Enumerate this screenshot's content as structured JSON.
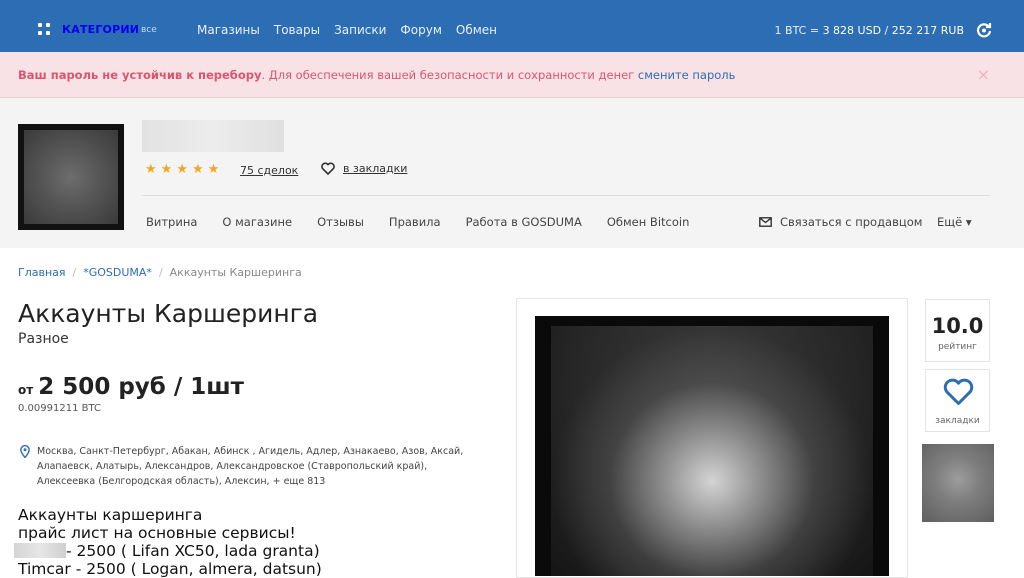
{
  "topbar": {
    "categories_label": "КАТЕГОРИИ",
    "categories_all": "все",
    "nav": [
      "Магазины",
      "Товары",
      "Записки",
      "Форум",
      "Обмен"
    ],
    "rate_prefix": "1 BTC = ",
    "rate_usd": "3 828 USD",
    "rate_sep": " / ",
    "rate_rub": "252 217 RUB"
  },
  "alert": {
    "bold": "Ваш пароль не устойчив к перебору",
    "text": ". Для обеспечения вашей безопасности и сохранности денег ",
    "link": "смените пароль",
    "close": "×"
  },
  "shop": {
    "rating_stars": 5,
    "deals": "75 сделок",
    "bookmark": "в закладки",
    "nav": [
      "Витрина",
      "О магазине",
      "Отзывы",
      "Правила",
      "Работа в GOSDUMA",
      "Обмен Bitcoin"
    ],
    "contact": "Связаться с продавцом",
    "more": "Ещё ▾"
  },
  "breadcrumb": {
    "home": "Главная",
    "sep": "/",
    "shop": "*GOSDUMA*",
    "current": "Аккаунты Каршеринга"
  },
  "product": {
    "title": "Аккаунты Каршеринга",
    "category": "Разное",
    "price_from": "от",
    "price": "2 500 руб / 1шт",
    "price_btc": "0.00991211 BTC",
    "cities": "Москва, Санкт-Петербург, Абакан, Абинск , Агидель, Адлер, Азнакаево, Азов, Аксай, Алапаевск, Алатырь, Александров, Александровское (Ставропольский край), Алексеевка (Белгородская область), Алексин, + еще 813",
    "desc_line1": "Аккаунты каршеринга",
    "desc_line2": "прайс лист на основные сервисы!",
    "desc_line3": "- 2500 ( Lifan XC50, lada granta)",
    "desc_line4": "Timcar - 2500 ( Logan, almera, datsun)"
  },
  "rail": {
    "rating": "10.0",
    "rating_label": "рейтинг",
    "fav_label": "закладки"
  },
  "colors": {
    "topbar": "#2c6db3",
    "alert_bg": "#f9e2e6",
    "alert_text": "#d9566f",
    "star": "#f5a623",
    "heart": "#2c6db3"
  }
}
